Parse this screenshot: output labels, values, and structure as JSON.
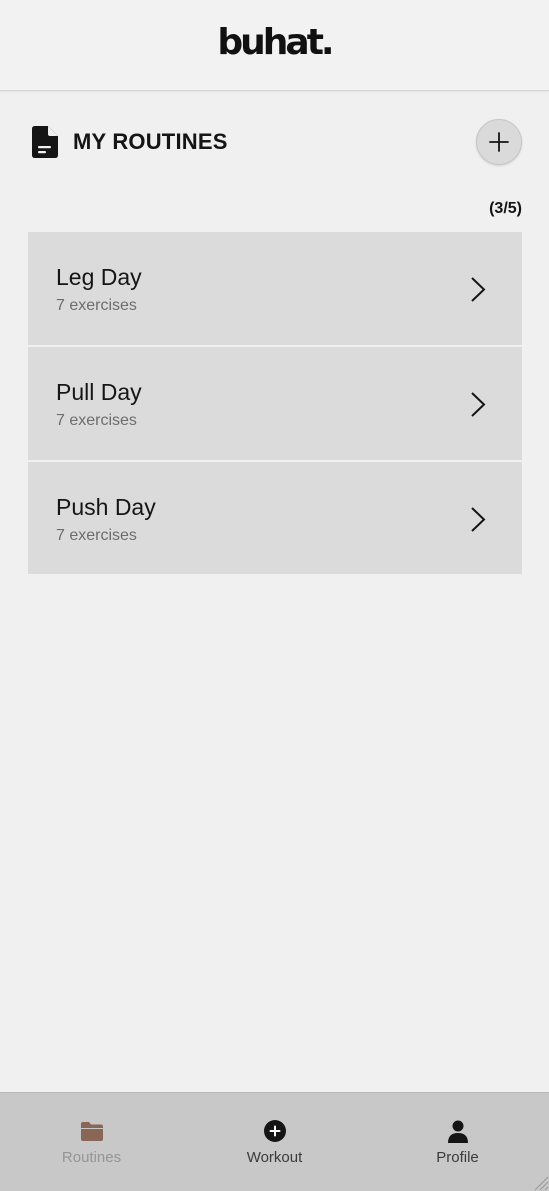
{
  "app": {
    "logo_text": "buhat."
  },
  "section": {
    "title": "MY ROUTINES",
    "icon": "document-icon",
    "add_icon": "plus-icon"
  },
  "routine_count": "(3/5)",
  "routines": [
    {
      "name": "Leg Day",
      "subtitle": "7 exercises"
    },
    {
      "name": "Pull Day",
      "subtitle": "7 exercises"
    },
    {
      "name": "Push Day",
      "subtitle": "7 exercises"
    }
  ],
  "nav": {
    "items": [
      {
        "label": "Routines",
        "icon": "folder-icon",
        "active": true
      },
      {
        "label": "Workout",
        "icon": "plus-circle-icon",
        "active": false
      },
      {
        "label": "Profile",
        "icon": "person-icon",
        "active": false
      }
    ]
  },
  "colors": {
    "background": "#f0f0f0",
    "card": "#dbdbdb",
    "nav_background": "#c8c8c8",
    "accent_folder": "#8a6657",
    "text": "#151515"
  }
}
